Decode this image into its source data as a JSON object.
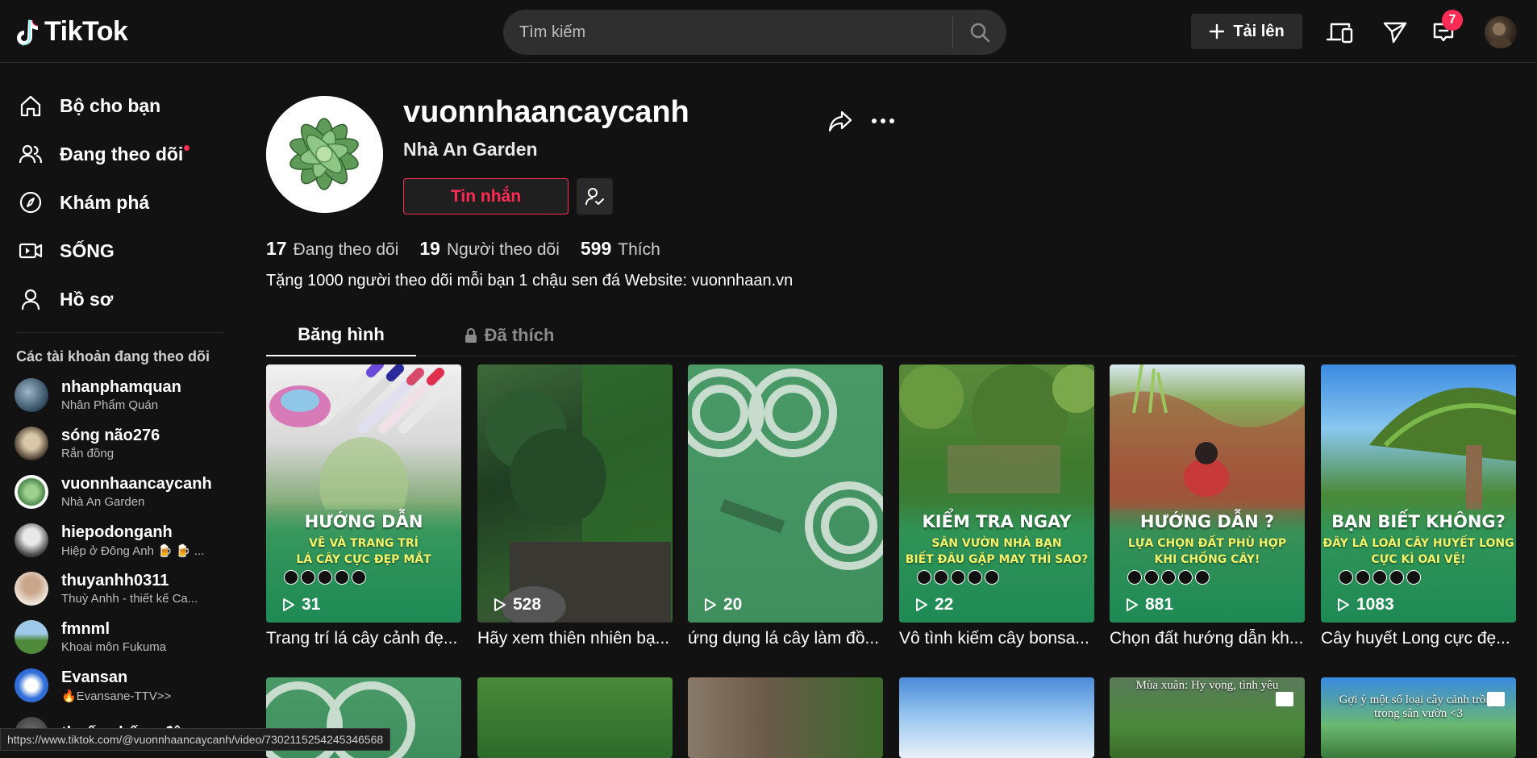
{
  "header": {
    "logo_text": "TikTok",
    "search_placeholder": "Tìm kiếm",
    "upload_label": "Tải lên",
    "inbox_badge": "7"
  },
  "sidebar": {
    "nav": [
      {
        "label": "Bộ cho bạn",
        "icon": "home-icon"
      },
      {
        "label": "Đang theo dõi",
        "icon": "users-icon"
      },
      {
        "label": "Khám phá",
        "icon": "compass-icon"
      },
      {
        "label": "SỐNG",
        "icon": "live-icon"
      },
      {
        "label": "Hồ sơ",
        "icon": "profile-icon"
      }
    ],
    "following_title": "Các tài khoản đang theo dõi",
    "accounts": [
      {
        "name": "nhanphamquan",
        "sub": "Nhân Phẩm Quán"
      },
      {
        "name": "sóng não276",
        "sub": "Rắn đồng"
      },
      {
        "name": "vuonnhaancaycanh",
        "sub": "Nhà An Garden"
      },
      {
        "name": "hiepodonganh",
        "sub": "Hiệp ở Đông Anh 🍺 🍺 ..."
      },
      {
        "name": "thuyanhh0311",
        "sub": "Thuỳ Anhh - thiết kế Ca..."
      },
      {
        "name": "fmnml",
        "sub": "Khoai môn Fukuma"
      },
      {
        "name": "Evansan",
        "sub": "🔥Evansane-TTV>>"
      },
      {
        "name": "thuốc chống đông",
        "sub": ""
      }
    ]
  },
  "status_url": "https://www.tiktok.com/@vuonnhaancaycanh/video/7302115254245346568",
  "profile": {
    "username": "vuonnhaancaycanh",
    "nickname": "Nhà An Garden",
    "message_label": "Tin nhắn",
    "stats": [
      {
        "value": "17",
        "label": "Đang theo dõi"
      },
      {
        "value": "19",
        "label": "Người theo dõi"
      },
      {
        "value": "599",
        "label": "Thích"
      }
    ],
    "bio": "Tặng 1000 người theo dõi mỗi bạn 1 chậu sen đá Website: vuonnhaan.vn"
  },
  "tabs": [
    {
      "label": "Băng hình",
      "active": true
    },
    {
      "label": "Đã thích",
      "locked": true
    }
  ],
  "videos": [
    {
      "views": "31",
      "caption": "Trang trí lá cây cảnh đẹ...",
      "title": "HƯỚNG DẪN",
      "sub1": "VẼ VÀ TRANG TRÍ",
      "sub2": "LÁ CÂY CỰC ĐẸP MẮT"
    },
    {
      "views": "528",
      "caption": "Hãy xem thiên nhiên bạ...",
      "title": "",
      "sub1": "",
      "sub2": ""
    },
    {
      "views": "20",
      "caption": "ứng dụng lá cây làm đồ...",
      "title": "",
      "sub1": "",
      "sub2": ""
    },
    {
      "views": "22",
      "caption": "Vô tình kiếm cây bonsa...",
      "title": "KIỂM TRA NGAY",
      "sub1": "SÂN VƯỜN NHÀ BẠN",
      "sub2": "BIẾT ĐÂU GẶP MAY THÌ SAO?"
    },
    {
      "views": "881",
      "caption": "Chọn đất hướng dẫn kh...",
      "title": "HƯỚNG DẪN ?",
      "sub1": "LỰA CHỌN ĐẤT PHÙ HỢP",
      "sub2": "KHI CHỒNG CÂY!"
    },
    {
      "views": "1083",
      "caption": "Cây huyết Long cực đẹ...",
      "title": "BẠN BIẾT KHÔNG?",
      "sub1": "ĐÂY LÀ LOÀI CÂY HUYẾT LONG",
      "sub2": "CỰC KÌ OAI VỆ!"
    }
  ],
  "row2": [
    {
      "text": ""
    },
    {
      "text": ""
    },
    {
      "text": ""
    },
    {
      "text": ""
    },
    {
      "text": "Mùa xuân: Hy vọng, tình yêu"
    },
    {
      "text": "Gợi ý một số loại cây cảnh trồng trong sân vườn <3"
    }
  ]
}
